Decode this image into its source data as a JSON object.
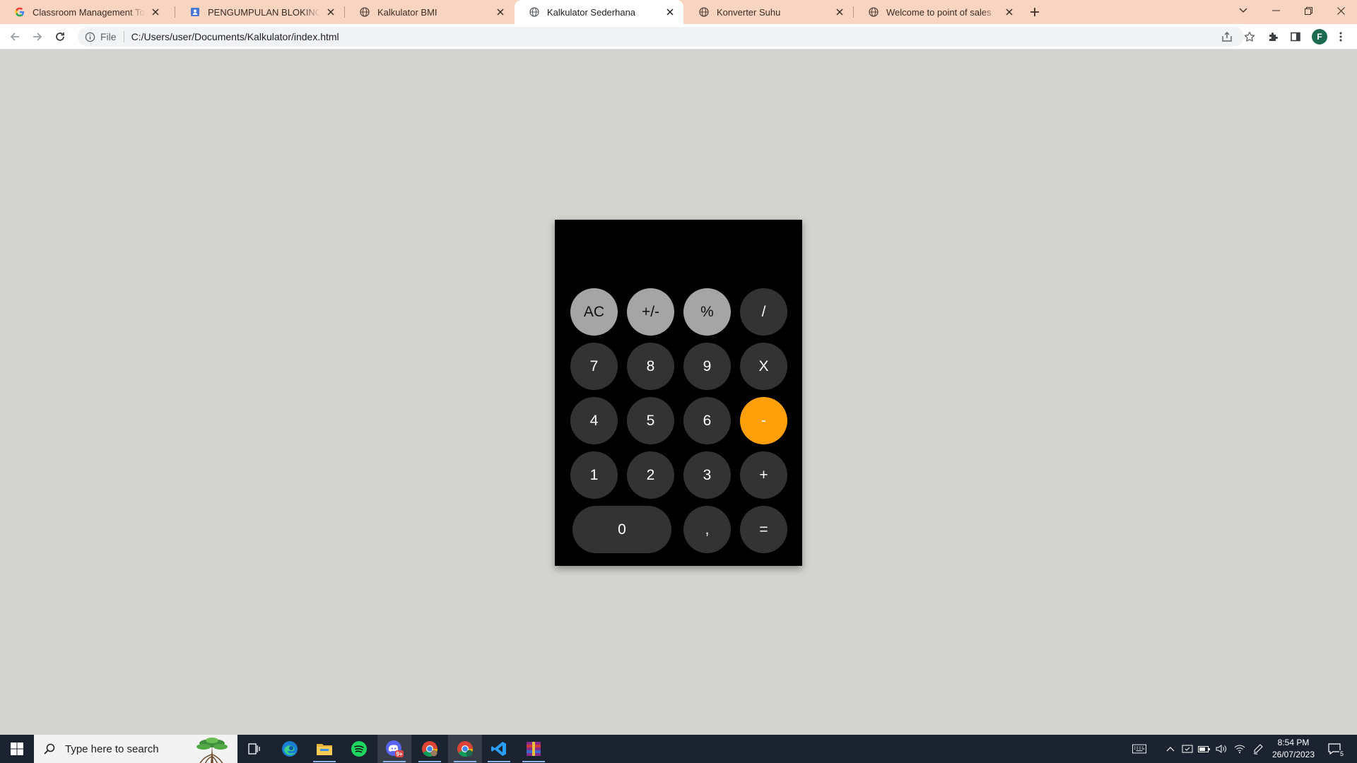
{
  "browser": {
    "tabs": [
      {
        "title": "Classroom Management Tools & ",
        "favicon": "google-icon",
        "active": false
      },
      {
        "title": "PENGUMPULAN BLOKING SELASA",
        "favicon": "forms-icon",
        "active": false
      },
      {
        "title": "Kalkulator BMI",
        "favicon": "globe-icon",
        "active": false
      },
      {
        "title": "Kalkulator Sederhana",
        "favicon": "globe-icon",
        "active": true
      },
      {
        "title": "Konverter Suhu",
        "favicon": "globe-icon",
        "active": false
      },
      {
        "title": "Welcome to point of sales",
        "favicon": "globe-icon",
        "active": false
      }
    ],
    "address": {
      "scheme_label": "File",
      "url": "C:/Users/user/Documents/Kalkulator/index.html"
    },
    "profile_initial": "F",
    "tab_strip_color": "#f8d4c1"
  },
  "calculator": {
    "display": "",
    "keys": [
      {
        "label": "AC",
        "kind": "function"
      },
      {
        "label": "+/-",
        "kind": "function"
      },
      {
        "label": "%",
        "kind": "function"
      },
      {
        "label": "/",
        "kind": "operator"
      },
      {
        "label": "7",
        "kind": "digit"
      },
      {
        "label": "8",
        "kind": "digit"
      },
      {
        "label": "9",
        "kind": "digit"
      },
      {
        "label": "X",
        "kind": "operator"
      },
      {
        "label": "4",
        "kind": "digit"
      },
      {
        "label": "5",
        "kind": "digit"
      },
      {
        "label": "6",
        "kind": "digit"
      },
      {
        "label": "-",
        "kind": "operator-active"
      },
      {
        "label": "1",
        "kind": "digit"
      },
      {
        "label": "2",
        "kind": "digit"
      },
      {
        "label": "3",
        "kind": "digit"
      },
      {
        "label": "+",
        "kind": "operator"
      },
      {
        "label": "0",
        "kind": "digit-wide"
      },
      {
        "label": ",",
        "kind": "digit"
      },
      {
        "label": "=",
        "kind": "operator"
      }
    ],
    "colors": {
      "body": "#000000",
      "digit": "#333333",
      "function": "#a5a5a5",
      "operator_active": "#ff9f0a"
    }
  },
  "taskbar": {
    "search_placeholder": "Type here to search",
    "apps": [
      "task-view-icon",
      "edge-icon",
      "file-explorer-icon",
      "spotify-icon",
      "discord-icon",
      "chrome-icon",
      "chrome-profile-icon",
      "vscode-icon",
      "winrar-icon"
    ],
    "discord_badge": "9+",
    "time": "8:54 PM",
    "date": "26/07/2023",
    "notification_count": "5"
  }
}
